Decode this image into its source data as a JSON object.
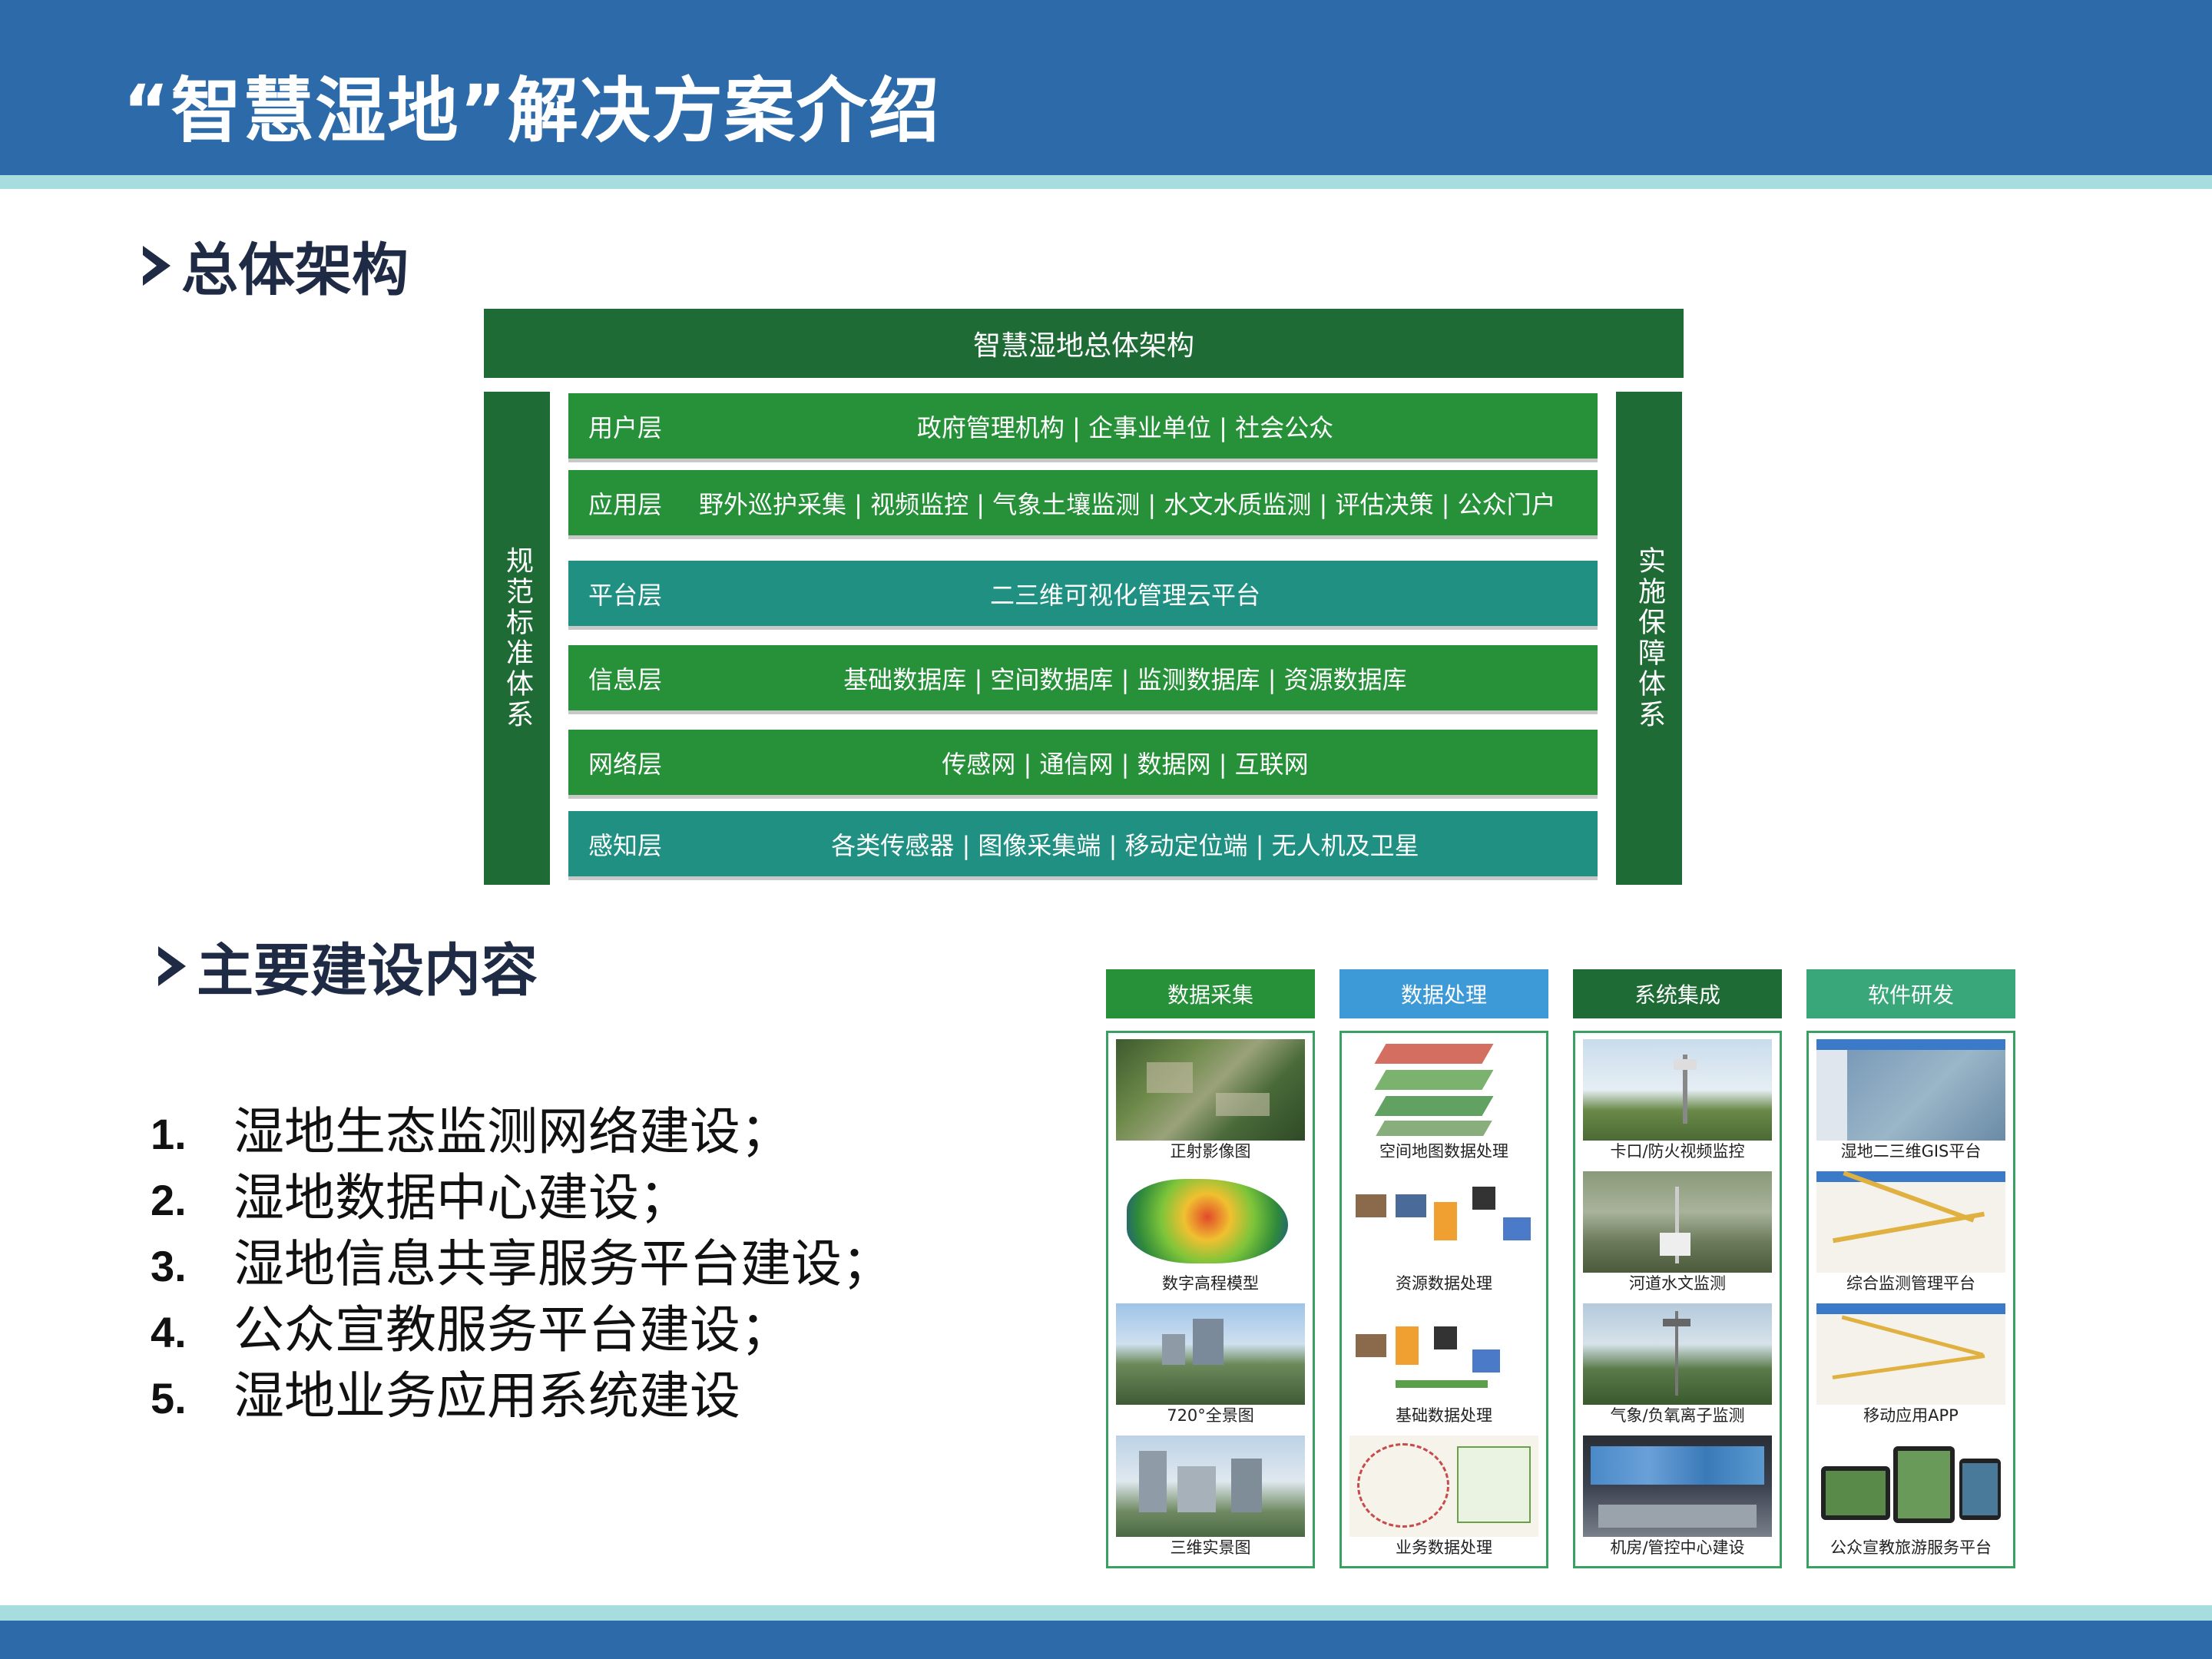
{
  "header": {
    "title": "“智慧湿地”解决方案介绍"
  },
  "sections": {
    "architecture": "总体架构",
    "construction": "主要建设内容"
  },
  "architecture": {
    "title": "智慧湿地总体架构",
    "left_column": "规范标准体系",
    "right_column": "实施保障体系",
    "layers": [
      {
        "name": "用户层",
        "content": "政府管理机构 | 企事业单位 | 社会公众",
        "color": "#27913a"
      },
      {
        "name": "应用层",
        "content": "野外巡护采集 | 视频监控 | 气象土壤监测 | 水文水质监测 | 评估决策 | 公众门户",
        "color": "#27913a"
      },
      {
        "name": "平台层",
        "content": "二三维可视化管理云平台",
        "color": "#209083"
      },
      {
        "name": "信息层",
        "content": "基础数据库 | 空间数据库 | 监测数据库 | 资源数据库",
        "color": "#27913a"
      },
      {
        "name": "网络层",
        "content": "传感网 | 通信网 | 数据网 | 互联网",
        "color": "#27913a"
      },
      {
        "name": "感知层",
        "content": "各类传感器 | 图像采集端 | 移动定位端 | 无人机及卫星",
        "color": "#209083"
      }
    ]
  },
  "construction_list": [
    {
      "num": "1.",
      "text": "湿地生态监测网络建设；"
    },
    {
      "num": "2.",
      "text": "湿地数据中心建设；"
    },
    {
      "num": "3.",
      "text": "湿地信息共享服务平台建设；"
    },
    {
      "num": "4.",
      "text": "公众宣教服务平台建设；"
    },
    {
      "num": "5.",
      "text": "湿地业务应用系统建设"
    }
  ],
  "grid": {
    "columns": [
      {
        "title": "数据采集",
        "color": "#27913a",
        "captions": [
          "正射影像图",
          "数字高程模型",
          "720°全景图",
          "三维实景图"
        ]
      },
      {
        "title": "数据处理",
        "color": "#3d9ad6",
        "captions": [
          "空间地图数据处理",
          "资源数据处理",
          "基础数据处理",
          "业务数据处理"
        ]
      },
      {
        "title": "系统集成",
        "color": "#1f6b35",
        "captions": [
          "卡口/防火视频监控",
          "河道水文监测",
          "气象/负氧离子监测",
          "机房/管控中心建设"
        ]
      },
      {
        "title": "软件研发",
        "color": "#3aa77a",
        "captions": [
          "湿地二三维GIS平台",
          "综合监测管理平台",
          "移动应用APP",
          "公众宣教旅游服务平台"
        ]
      }
    ]
  }
}
